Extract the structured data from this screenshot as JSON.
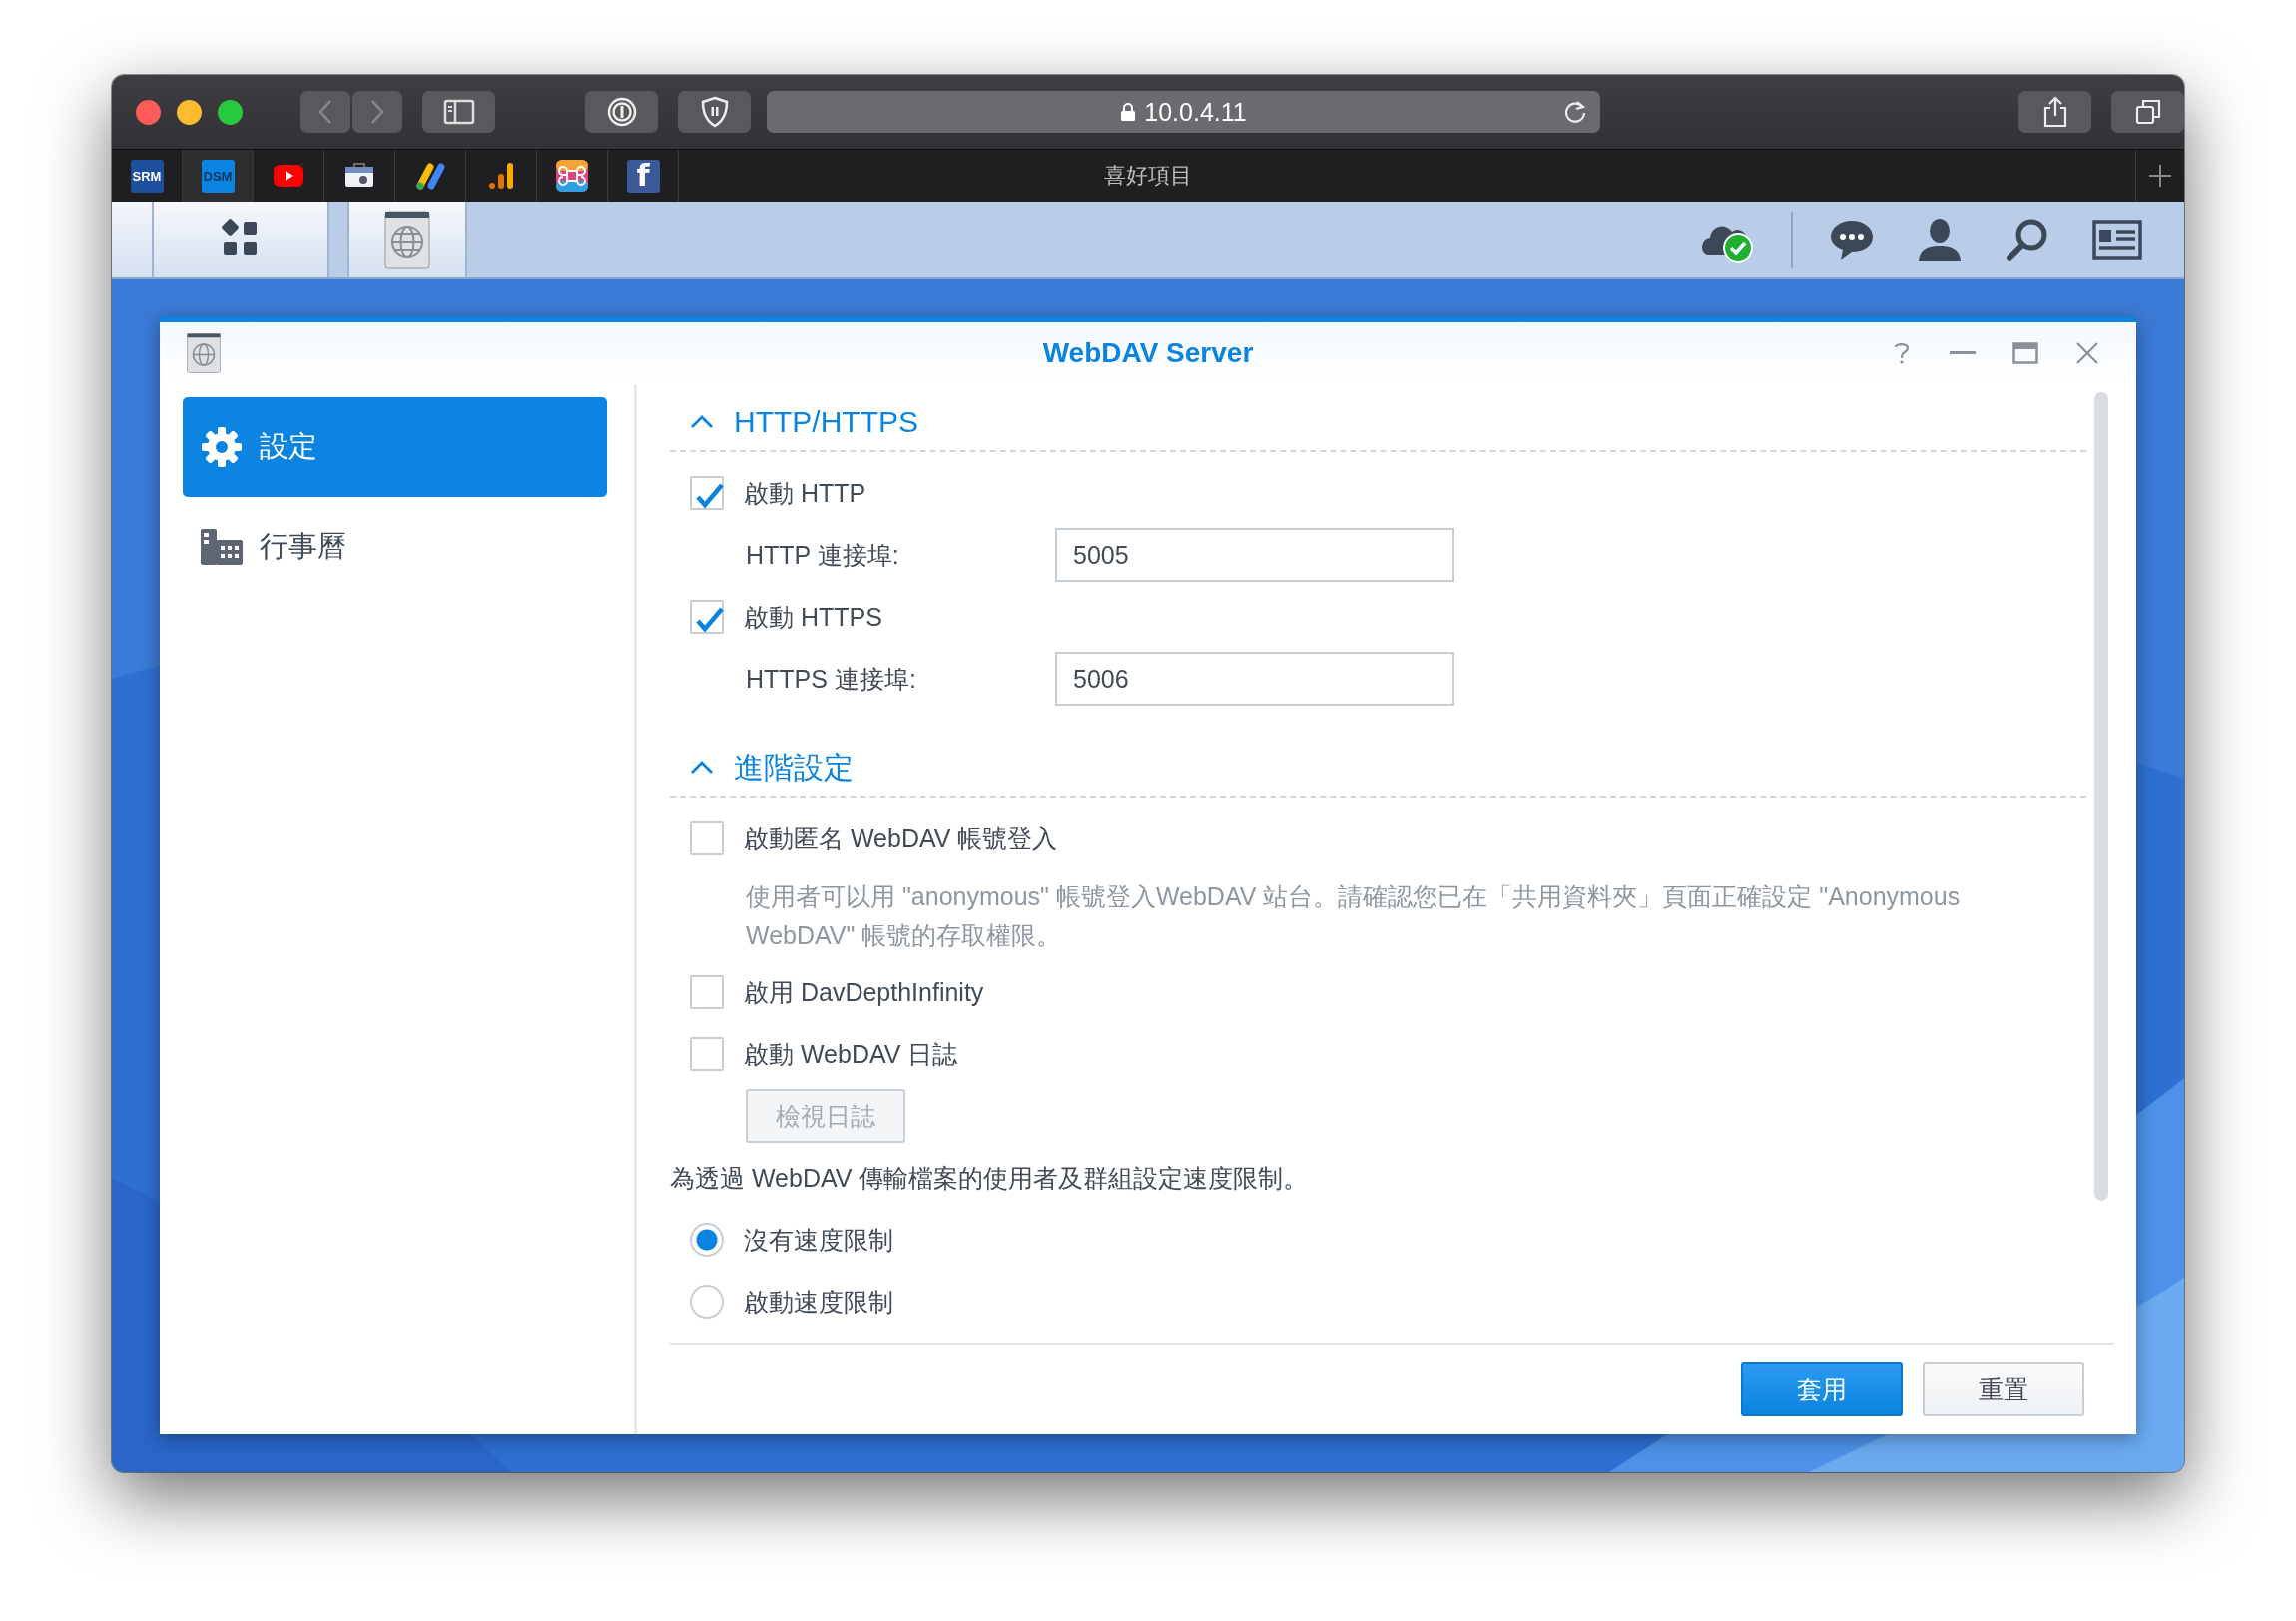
{
  "browser": {
    "address": "10.0.4.11",
    "favorites_title": "喜好項目",
    "bookmarks": [
      {
        "kind": "srm",
        "label": "SRM"
      },
      {
        "kind": "dsm",
        "label": "DSM"
      },
      {
        "kind": "youtube"
      },
      {
        "kind": "toolbox"
      },
      {
        "kind": "ads"
      },
      {
        "kind": "analytics"
      },
      {
        "kind": "command"
      },
      {
        "kind": "facebook",
        "label": "f"
      }
    ]
  },
  "window": {
    "title": "WebDAV Server"
  },
  "sidebar": {
    "items": [
      {
        "kind": "settings",
        "label": "設定",
        "selected": true
      },
      {
        "kind": "calendar",
        "label": "行事曆",
        "selected": false
      }
    ]
  },
  "sections": [
    {
      "title": "HTTP/HTTPS",
      "expanded": true,
      "items": [
        {
          "kind": "checkbox",
          "label": "啟動 HTTP",
          "checked": true
        },
        {
          "kind": "field",
          "label": "HTTP 連接埠:",
          "value": "5005"
        },
        {
          "kind": "checkbox",
          "label": "啟動 HTTPS",
          "checked": true
        },
        {
          "kind": "field",
          "label": "HTTPS 連接埠:",
          "value": "5006"
        }
      ]
    },
    {
      "title": "進階設定",
      "expanded": true,
      "items": [
        {
          "kind": "checkbox",
          "label": "啟動匿名 WebDAV 帳號登入",
          "checked": false
        },
        {
          "kind": "note",
          "text": "使用者可以用 \"anonymous\" 帳號登入WebDAV 站台。請確認您已在「共用資料夾」頁面正確設定 \"Anonymous WebDAV\" 帳號的存取權限。"
        },
        {
          "kind": "checkbox",
          "label": "啟用 DavDepthInfinity",
          "checked": false
        },
        {
          "kind": "checkbox",
          "label": "啟動 WebDAV 日誌",
          "checked": false
        },
        {
          "kind": "button",
          "label": "檢視日誌",
          "disabled": true
        },
        {
          "kind": "text",
          "text": "為透過 WebDAV 傳輸檔案的使用者及群組設定速度限制。"
        },
        {
          "kind": "radio",
          "label": "沒有速度限制",
          "selected": true
        },
        {
          "kind": "radio",
          "label": "啟動速度限制",
          "selected": false
        }
      ]
    }
  ],
  "footer": {
    "buttons": [
      {
        "kind": "primary",
        "label": "套用"
      },
      {
        "kind": "secondary",
        "label": "重置"
      }
    ]
  }
}
